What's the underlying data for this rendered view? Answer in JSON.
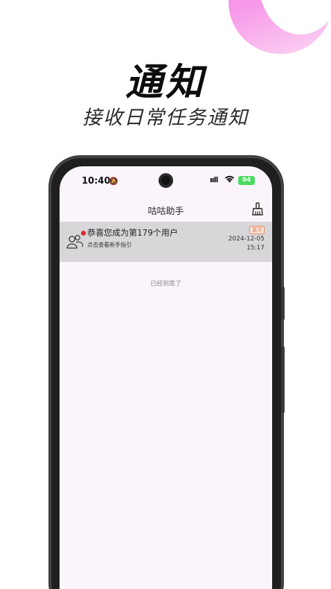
{
  "promo": {
    "title": "通知",
    "subtitle": "接收日常任务通知"
  },
  "status_bar": {
    "time": "10:40",
    "battery": "94"
  },
  "header": {
    "title": "咕咕助手"
  },
  "notifications": [
    {
      "title": "恭喜您成为第179个用户",
      "description": "点击查看新手指引",
      "badge": "置顶",
      "date": "2024-12-05",
      "time": "15:17"
    }
  ],
  "list_end_text": "已经到底了",
  "colors": {
    "accent_pink": "#ff7ee3",
    "unread_dot": "#d52b2b",
    "badge": "#e8865e",
    "battery": "#4cd964"
  }
}
